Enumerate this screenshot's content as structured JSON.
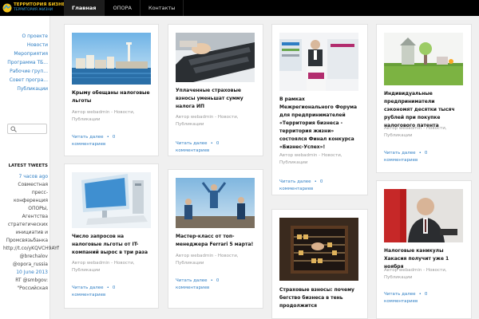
{
  "header": {
    "logo_title": "ТЕРРИТОРИЯ БИЗНЕСА",
    "logo_subtitle": "ТЕРРИТОРИЯ ЖИЗНИ",
    "nav": [
      {
        "label": "Главная"
      },
      {
        "label": "ОПОРА"
      },
      {
        "label": "Контакты"
      }
    ]
  },
  "sidebar": {
    "menu": [
      "О проекте",
      "Новости",
      "Мероприятия",
      "Программа ТБ...",
      "Рабочие груп...",
      "Совет програ...",
      "Публикации"
    ],
    "search_placeholder": "",
    "tweets_title": "LATEST TWEETS",
    "tweets": [
      {
        "time": "7 часов ago",
        "text": "Совместная пресс-конференция ОПОРЫ, Агентства стратегических инициатив и Промсвязьбанка http://t.co/yKQVCH9AYf @brechalov @opora_russia"
      },
      {
        "time": "10 June 2013",
        "text": "RT @smbgov: \"Российская"
      }
    ]
  },
  "common": {
    "meta_author": "Автор webadmin - Новости,",
    "meta_category": "Публикации",
    "read_more": "Читать далее",
    "comments_count": "0",
    "comments_label": "комментариев"
  },
  "cards": [
    {
      "title": "Крыму обещаны налоговые льготы"
    },
    {
      "title": "Уплаченные страховые взносы уменьшат сумму налога ИП"
    },
    {
      "title": "В рамках Межрегионального Форума для предпринимателей «Территория бизнеса - территория жизни» состоялся Финал конкурса «Бизнес-Успех»!"
    },
    {
      "title": "Индивидуальные предприниматели сэкономят десятки тысяч рублей при покупке налогового патента"
    },
    {
      "title": "Число запросов на налоговые льготы от IT-компаний вырос в три раза"
    },
    {
      "title": "Мастер-класс от топ-менеджера Ferrari 5 марта!"
    },
    {
      "title": "Страховые взносы: почему бегство бизнеса в тень продолжится"
    },
    {
      "title": "Налоговые каникулы Хакасия получит уже 1 ноября"
    }
  ]
}
